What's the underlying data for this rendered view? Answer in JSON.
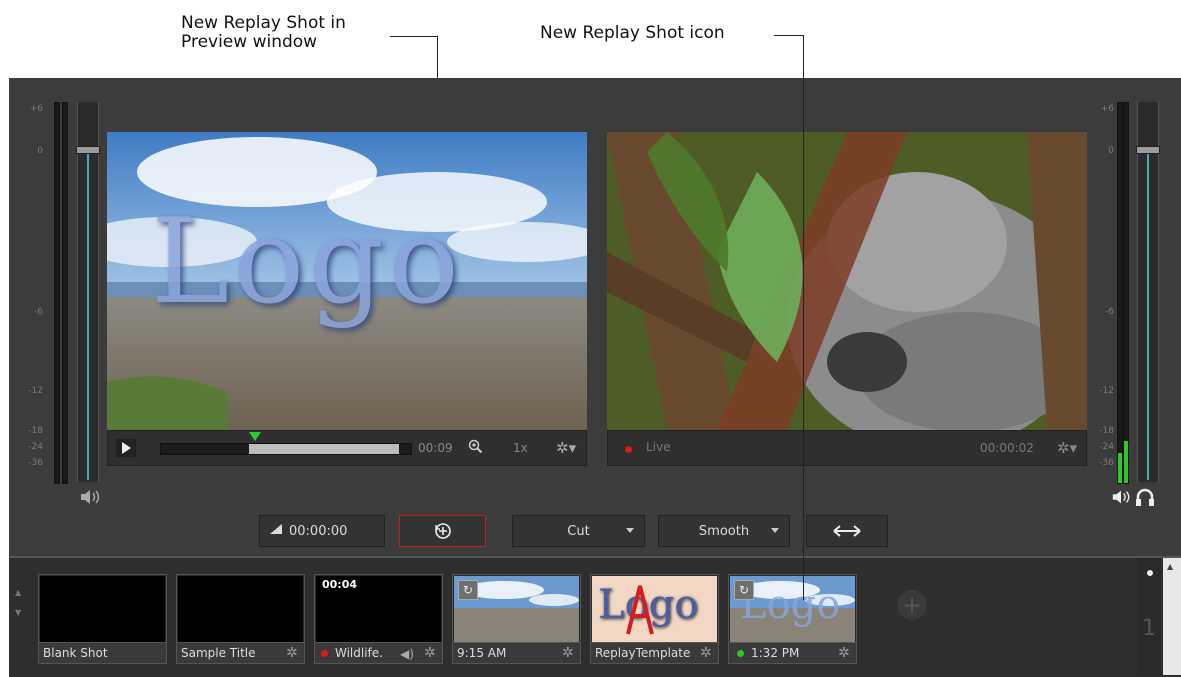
{
  "callouts": {
    "preview_line1": "New Replay Shot in",
    "preview_line2": "Preview window",
    "icon": "New Replay Shot icon"
  },
  "meters": {
    "left_scale": [
      "+6",
      "0",
      "-6",
      "-12",
      "-18",
      "-24",
      "-36"
    ],
    "right_scale": [
      "+6",
      "0",
      "-6",
      "-12",
      "-18",
      "-24",
      "-36"
    ]
  },
  "preview": {
    "logo_text": "Logo",
    "timecode": "00:09",
    "speed": "1x",
    "progress": 0.6
  },
  "program": {
    "live_label": "Live",
    "timecode": "00:00:02",
    "live_color": "#e01818"
  },
  "transport": {
    "duration": "00:00:00",
    "transition": "Cut",
    "easing": "Smooth"
  },
  "shots": [
    {
      "label": "Blank Shot"
    },
    {
      "label": "Sample Title"
    },
    {
      "label": "Wildlife.",
      "overlay": "00:04",
      "dot": "#e01818"
    },
    {
      "label": "9:15 AM"
    },
    {
      "label": "ReplayTemplate",
      "logo": "Logo"
    },
    {
      "label": "1:32 PM",
      "logo": "Logo",
      "dot": "#2ec82e"
    }
  ],
  "shotbar": {
    "page_number": "1"
  },
  "icons": {
    "play": "play-icon",
    "zoom": "zoom-icon",
    "gear": "gear-icon",
    "speaker": "speaker-icon",
    "headphones": "headphones-icon",
    "replay": "replay-icon",
    "swap": "swap-arrows-icon",
    "add": "add-shot-icon"
  }
}
